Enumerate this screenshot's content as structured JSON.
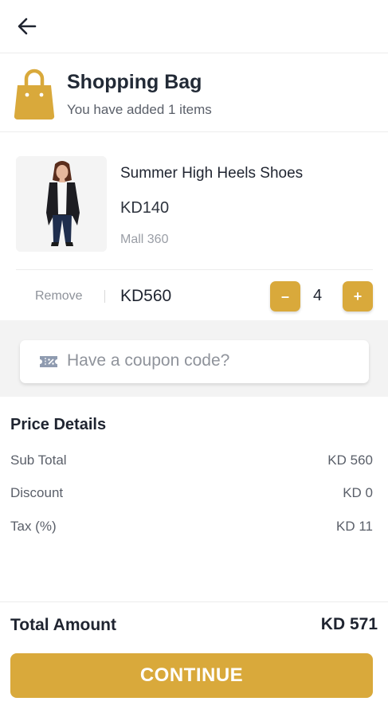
{
  "header": {
    "back_icon": "arrow-left-icon"
  },
  "bag": {
    "icon": "shopping-bag-icon",
    "title": "Shopping Bag",
    "subtitle": "You have added 1 items"
  },
  "cart": {
    "items": [
      {
        "image": "product-photo",
        "name": "Summer High Heels Shoes",
        "price": "KD140",
        "store": "Mall 360",
        "remove_label": "Remove",
        "line_total": "KD560",
        "quantity": "4",
        "minus_label": "–",
        "plus_label": "+"
      }
    ]
  },
  "coupon": {
    "icon": "coupon-ticket-icon",
    "placeholder": "Have a coupon code?"
  },
  "price_details": {
    "title": "Price Details",
    "rows": [
      {
        "label": "Sub Total",
        "value": "KD 560"
      },
      {
        "label": "Discount",
        "value": "KD 0"
      },
      {
        "label": "Tax (%)",
        "value": "KD 11"
      }
    ]
  },
  "total": {
    "label": "Total Amount",
    "value": "KD 571"
  },
  "continue_label": "CONTINUE",
  "colors": {
    "accent": "#d9a93b",
    "text": "#1f2430",
    "muted": "#8e929a",
    "band": "#f3f3f3"
  }
}
